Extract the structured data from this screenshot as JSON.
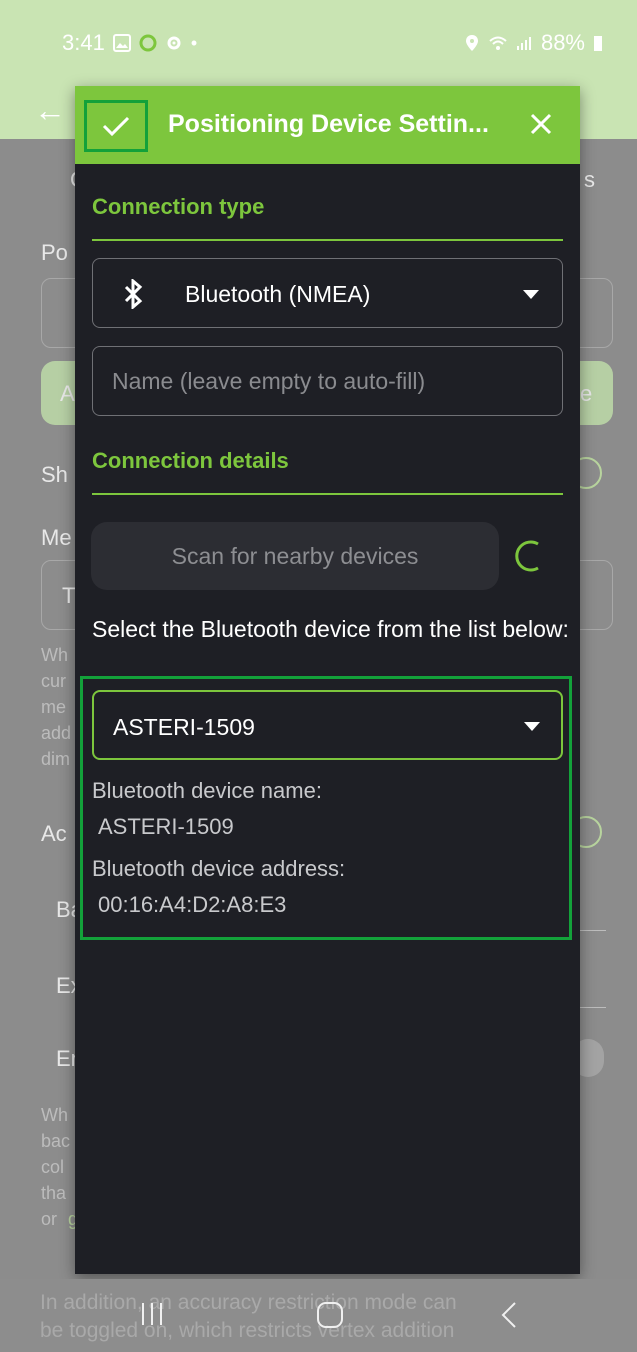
{
  "status_bar": {
    "time": "3:41",
    "battery": "88%",
    "icons": [
      "gallery-icon",
      "app-icon",
      "gear-icon",
      "dot-icon",
      "location-icon",
      "wifi-icon",
      "signal-icon",
      "battery-icon"
    ]
  },
  "background": {
    "frag_1": "C",
    "frag_2": "s",
    "frag_3": "Po",
    "frag_4": "A",
    "frag_5": "e",
    "frag_6": "Sh",
    "frag_7": "Me",
    "frag_8": "T",
    "frag_9": "Wh",
    "frag_10": "cur",
    "frag_11": "me",
    "frag_12": "add",
    "frag_13": "dim",
    "frag_14": "Ac",
    "frag_15": "Ba",
    "frag_16": "Ex",
    "frag_17": "Er",
    "frag_18": "Wh",
    "frag_19": "bac",
    "frag_20": "col",
    "frag_21": "tha",
    "frag_22": "or",
    "frag_23": "g",
    "footer_line1": "In addition, an accuracy restriction mode can",
    "footer_line2": "be toggled on, which restricts vertex addition"
  },
  "dialog": {
    "title": "Positioning Device Settin...",
    "connection_type_title": "Connection type",
    "connection_type_value": "Bluetooth (NMEA)",
    "name_placeholder": "Name (leave empty to auto-fill)",
    "connection_details_title": "Connection details",
    "scan_label": "Scan for nearby devices",
    "prompt": "Select the Bluetooth device from the list below:",
    "selected_device": "ASTERI-1509",
    "device_name_label": "Bluetooth device name:",
    "device_name_value": "ASTERI-1509",
    "device_address_label": "Bluetooth device address:",
    "device_address_value": "00:16:A4:D2:A8:E3"
  },
  "colors": {
    "accent": "#7dc63d",
    "highlight": "#13a13a",
    "dialog_bg": "#1e1f25"
  }
}
